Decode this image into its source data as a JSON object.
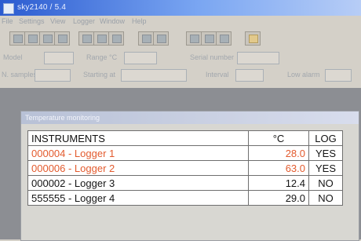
{
  "window": {
    "title": "sky2140 / 5.4"
  },
  "menu": [
    "File",
    "Settings",
    "View",
    "Logger",
    "Window",
    "Help"
  ],
  "toolbar": {
    "buttons": [
      "open-icon",
      "save-icon",
      "print-icon",
      "table-icon",
      "grid-icon",
      "search-icon",
      "monitor-icon",
      "chart-icon",
      "config-icon",
      "export-icon",
      "settings-icon",
      "help-icon"
    ]
  },
  "fields": {
    "model_label": "Model",
    "range_label": "Range °C",
    "serial_label": "Serial number",
    "samples_label": "N. samples",
    "starting_label": "Starting at",
    "interval_label": "Interval",
    "low_alarm_label": "Low alarm"
  },
  "child_window": {
    "title": "Temperature monitoring"
  },
  "table": {
    "headers": [
      "INSTRUMENTS",
      "°C",
      "LOG"
    ],
    "rows": [
      {
        "instrument": "000004 - Logger 1",
        "temp": "28.0",
        "log": "YES",
        "alarm": true
      },
      {
        "instrument": "000006 - Logger 2",
        "temp": "63.0",
        "log": "YES",
        "alarm": true
      },
      {
        "instrument": "000002 - Logger 3",
        "temp": "12.4",
        "log": "NO",
        "alarm": false
      },
      {
        "instrument": "555555 - Logger 4",
        "temp": "29.0",
        "log": "NO",
        "alarm": false
      }
    ]
  },
  "colors": {
    "alarm_text": "#e35b2e",
    "normal_text": "#151515",
    "titlebar": "#2b5bd0"
  }
}
